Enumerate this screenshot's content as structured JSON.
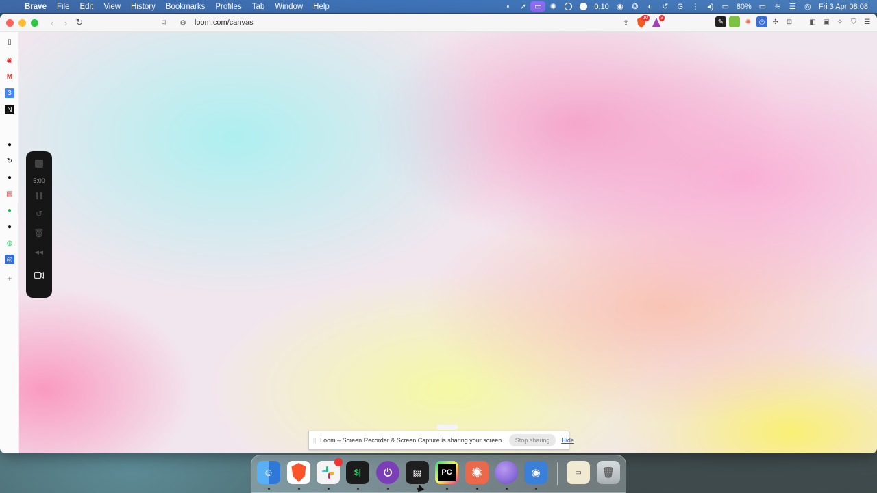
{
  "menubar": {
    "app_name": "Brave",
    "items": [
      "File",
      "Edit",
      "View",
      "History",
      "Bookmarks",
      "Profiles",
      "Tab",
      "Window",
      "Help"
    ],
    "timer": "0:10",
    "battery": "80%",
    "datetime": "Fri 3 Apr  08:08"
  },
  "browser": {
    "url": "loom.com/canvas",
    "shield_badge": "10",
    "rewards_badge": "3"
  },
  "sidebar": {
    "icons": [
      "record-icon",
      "gmail-icon",
      "google-calendar-icon",
      "notion-icon",
      "github-icon",
      "refresh-app-icon",
      "github-icon",
      "chart-app-icon",
      "spotify-icon",
      "github-icon",
      "whatsapp-icon",
      "app-icon",
      "add-icon"
    ]
  },
  "loom_controls": {
    "time_remaining": "5:00"
  },
  "share_bar": {
    "message": "Loom – Screen Recorder & Screen Capture is sharing your screen.",
    "stop_label": "Stop sharing",
    "hide_label": "Hide"
  },
  "dock": {
    "apps": [
      "finder-icon",
      "brave-icon",
      "slack-icon",
      "terminal-icon",
      "power-app-icon",
      "zed-icon",
      "pycharm-icon",
      "claude-icon",
      "orb-app-icon",
      "preview-icon",
      "stack-icon",
      "trash-icon"
    ],
    "colors": {
      "finder": "#3b8be6",
      "brave": "#fb542b",
      "slack": "#e8e8e8",
      "terminal": "#1b1b1b",
      "power": "#7a3fb8",
      "zed": "#1f1f1f",
      "pycharm": "#111111",
      "claude": "#e9694a",
      "orb": "#8a6ae0",
      "preview": "#3a7fd8"
    }
  }
}
